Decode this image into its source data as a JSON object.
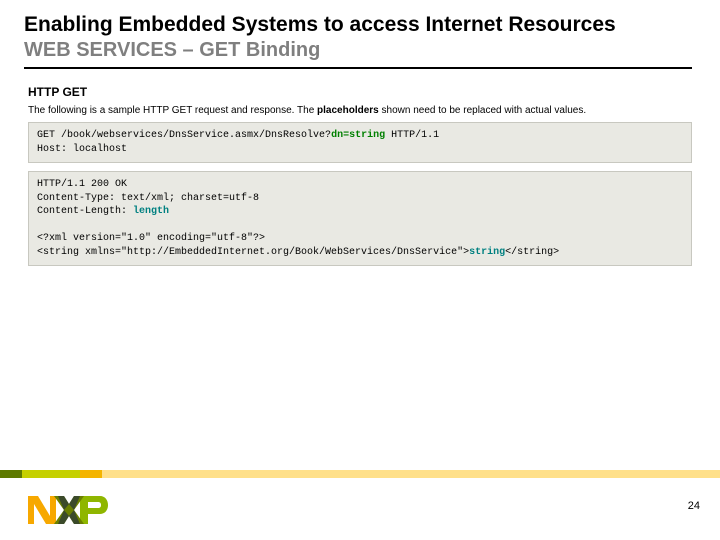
{
  "title": {
    "main": "Enabling Embedded Systems to access Internet Resources",
    "sub": "WEB SERVICES – GET Binding"
  },
  "section_label": "HTTP GET",
  "intro_prefix": "The following is a sample HTTP GET request and response. The ",
  "intro_bold": "placeholders",
  "intro_suffix": " shown need to be replaced with actual values.",
  "req_line1_a": "GET /book/webservices/DnsService.asmx/DnsResolve?",
  "req_line1_b": "dn=string",
  "req_line1_c": " HTTP/1.1",
  "req_line2": "Host: localhost",
  "resp_line1": "HTTP/1.1 200 OK",
  "resp_line2": "Content-Type: text/xml; charset=utf-8",
  "resp_line3_a": "Content-Length: ",
  "resp_line3_b": "length",
  "resp_blank": "",
  "resp_line4": "<?xml version=\"1.0\" encoding=\"utf-8\"?>",
  "resp_line5_a": "<string xmlns=\"http://EmbeddedInternet.org/Book/WebServices/DnsService\">",
  "resp_line5_b": "string",
  "resp_line5_c": "</string>",
  "page_number": "24",
  "logo_alt": "NXP"
}
